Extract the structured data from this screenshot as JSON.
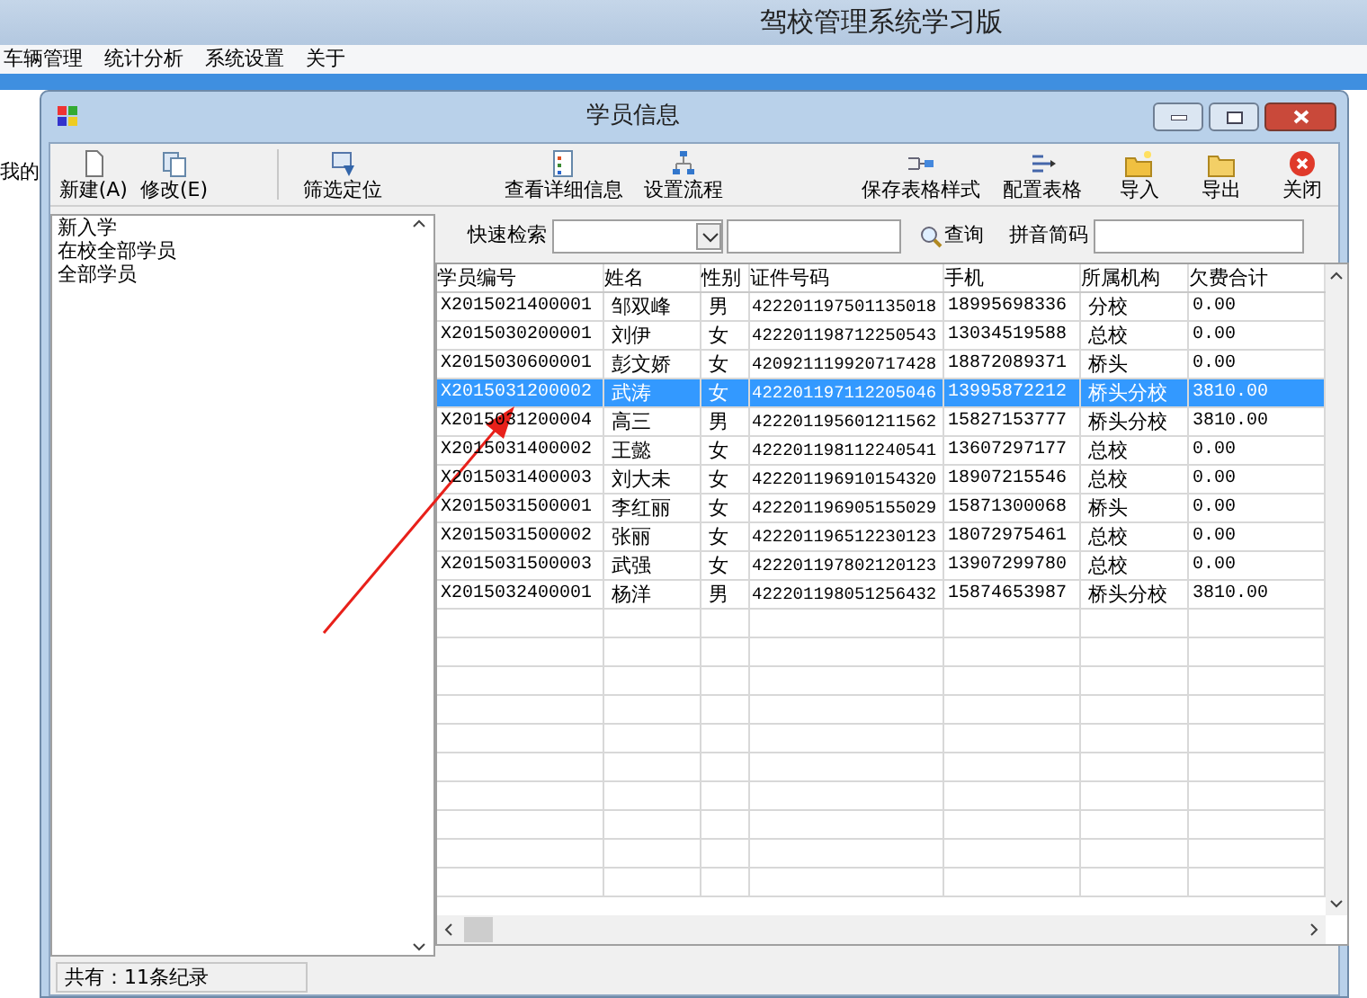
{
  "app": {
    "title": "驾校管理系统学习版",
    "menu": [
      "车辆管理",
      "统计分析",
      "系统设置",
      "关于"
    ],
    "side_text": "我的"
  },
  "window": {
    "title": "学员信息"
  },
  "toolbar": [
    {
      "label": "新建(A)",
      "kind": "new"
    },
    {
      "label": "修改(E)",
      "kind": "edit"
    },
    {
      "label": "筛选定位",
      "kind": "filter"
    },
    {
      "label": "查看详细信息",
      "kind": "details"
    },
    {
      "label": "设置流程",
      "kind": "flow"
    },
    {
      "label": "保存表格样式",
      "kind": "save-layout"
    },
    {
      "label": "配置表格",
      "kind": "configure"
    },
    {
      "label": "导入",
      "kind": "import"
    },
    {
      "label": "导出",
      "kind": "export"
    },
    {
      "label": "关闭",
      "kind": "close"
    }
  ],
  "categories": [
    "新入学",
    "在校全部学员",
    "全部学员"
  ],
  "search": {
    "label": "快速检索",
    "query_button": "查询",
    "pinyin_label": "拼音简码"
  },
  "table": {
    "columns": [
      "学员编号",
      "姓名",
      "性别",
      "证件号码",
      "手机",
      "所属机构",
      "欠费合计"
    ],
    "rows": [
      {
        "cells": [
          "X2015021400001",
          "邹双峰",
          "男",
          "422201197501135018",
          "18995698336",
          "分校",
          "0.00"
        ],
        "selected": false
      },
      {
        "cells": [
          "X2015030200001",
          "刘伊",
          "女",
          "422201198712250543",
          "13034519588",
          "总校",
          "0.00"
        ],
        "selected": false
      },
      {
        "cells": [
          "X2015030600001",
          "彭文娇",
          "女",
          "420921119920717428",
          "18872089371",
          "桥头",
          "0.00"
        ],
        "selected": false
      },
      {
        "cells": [
          "X2015031200002",
          "武涛",
          "女",
          "422201197112205046",
          "13995872212",
          "桥头分校",
          "3810.00"
        ],
        "selected": true
      },
      {
        "cells": [
          "X2015031200004",
          "高三",
          "男",
          "422201195601211562",
          "15827153777",
          "桥头分校",
          "3810.00"
        ],
        "selected": false
      },
      {
        "cells": [
          "X2015031400002",
          "王懿",
          "女",
          "422201198112240541",
          "13607297177",
          "总校",
          "0.00"
        ],
        "selected": false
      },
      {
        "cells": [
          "X2015031400003",
          "刘大未",
          "女",
          "422201196910154320",
          "18907215546",
          "总校",
          "0.00"
        ],
        "selected": false
      },
      {
        "cells": [
          "X2015031500001",
          "李红丽",
          "女",
          "422201196905155029",
          "15871300068",
          "桥头",
          "0.00"
        ],
        "selected": false
      },
      {
        "cells": [
          "X2015031500002",
          "张丽",
          "女",
          "422201196512230123",
          "18072975461",
          "总校",
          "0.00"
        ],
        "selected": false
      },
      {
        "cells": [
          "X2015031500003",
          "武强",
          "女",
          "422201197802120123",
          "13907299780",
          "总校",
          "0.00"
        ],
        "selected": false
      },
      {
        "cells": [
          "X2015032400001",
          "杨洋",
          "男",
          "422201198051256432",
          "15874653987",
          "桥头分校",
          "3810.00"
        ],
        "selected": false
      }
    ]
  },
  "status": "共有：11条纪录"
}
